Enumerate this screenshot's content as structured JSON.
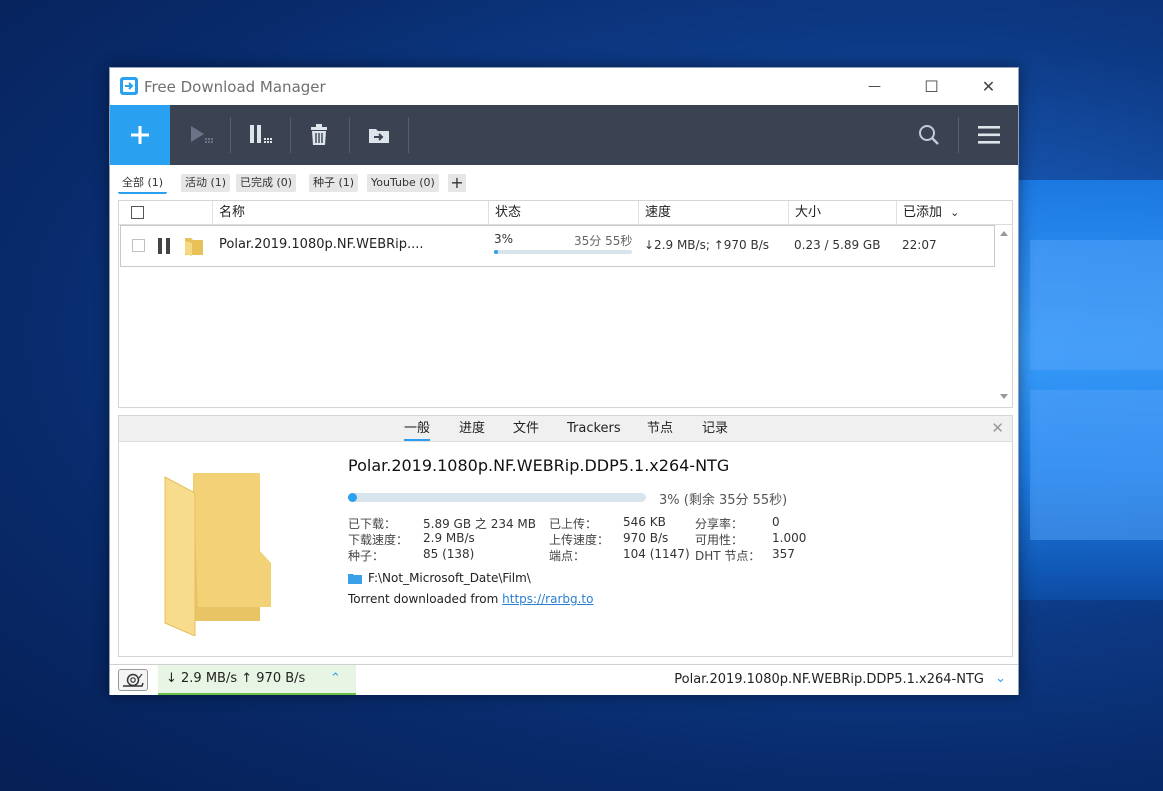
{
  "window": {
    "title": "Free Download Manager",
    "minimize_symbol": "—",
    "maximize_symbol": "☐",
    "close_symbol": "✕"
  },
  "toolbar": {
    "icons": [
      "add-icon",
      "resume-icon",
      "pause-icon",
      "delete-icon",
      "move-icon",
      "search-icon",
      "menu-icon"
    ],
    "accent_color": "#29a0f0",
    "background_color": "#3b4252"
  },
  "filters": {
    "items": [
      {
        "label": "全部 (1)",
        "active": true
      },
      {
        "label": "活动 (1)",
        "active": false
      },
      {
        "label": "已完成 (0)",
        "active": false
      },
      {
        "label": "种子 (1)",
        "active": false
      },
      {
        "label": "YouTube (0)",
        "active": false
      }
    ],
    "add_label": "+"
  },
  "list": {
    "columns": [
      "名称",
      "状态",
      "速度",
      "大小",
      "已添加"
    ],
    "sort_indicator": "⌄",
    "rows": [
      {
        "name": "Polar.2019.1080p.NF.WEBRip....",
        "progress_text": "3%",
        "progress_value": 0.03,
        "eta": "35分 55秒",
        "speed": "↓2.9 MB/s; ↑970 B/s",
        "size": "0.23 / 5.89 GB",
        "added": "22:07"
      }
    ]
  },
  "details": {
    "tabs": [
      "一般",
      "进度",
      "文件",
      "Trackers",
      "节点",
      "记录"
    ],
    "active_tab": "一般",
    "title": "Polar.2019.1080p.NF.WEBRip.DDP5.1.x264-NTG",
    "progress_value": 0.03,
    "progress_text": "3% (剩余 35分 55秒)",
    "stats": {
      "downloaded_label": "已下载：",
      "downloaded": "5.89 GB 之 234 MB",
      "dl_speed_label": "下载速度：",
      "dl_speed": "2.9 MB/s",
      "seeds_label": "种子：",
      "seeds": "85 (138)",
      "uploaded_label": "已上传：",
      "uploaded": "546 KB",
      "ul_speed_label": "上传速度：",
      "ul_speed": "970 B/s",
      "peers_label": "端点：",
      "peers": "104 (1147)",
      "ratio_label": "分享率：",
      "ratio": "0",
      "availability_label": "可用性：",
      "availability": "1.000",
      "dht_label": "DHT 节点：",
      "dht": "357"
    },
    "path": "F:\\Not_Microsoft_Date\\Film\\",
    "source_prefix": "Torrent downloaded from",
    "source_link": "https://rarbg.to"
  },
  "statusbar": {
    "speed": "↓  2.9 MB/s  ↑ 970 B/s",
    "current_download": "Polar.2019.1080p.NF.WEBRip.DDP5.1.x264-NTG",
    "expand_symbol": "⌃",
    "collapse_symbol": "⌄"
  }
}
